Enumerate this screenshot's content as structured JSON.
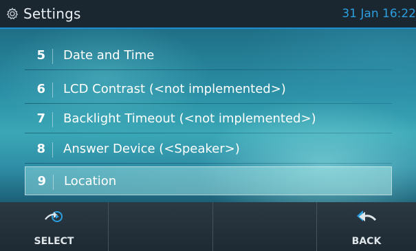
{
  "header": {
    "title": "Settings",
    "clock": "31 Jan 16:22",
    "icon": "gear-icon"
  },
  "colors": {
    "accent": "#1d8fd1",
    "clock": "#2b9fe0",
    "header_bg": "#1b2730",
    "footer_bg": "#24323c"
  },
  "menu": {
    "items": [
      {
        "number": "5",
        "label": "Date and Time"
      },
      {
        "number": "6",
        "label": "LCD Contrast (<not implemented>)"
      },
      {
        "number": "7",
        "label": "Backlight Timeout (<not implemented>)"
      },
      {
        "number": "8",
        "label": "Answer Device (<Speaker>)"
      },
      {
        "number": "9",
        "label": "Location"
      }
    ],
    "selected_index": 4
  },
  "softkeys": [
    {
      "label": "SELECT",
      "icon": "select-arrow-icon"
    },
    {
      "label": "",
      "icon": ""
    },
    {
      "label": "",
      "icon": ""
    },
    {
      "label": "BACK",
      "icon": "back-arrow-icon"
    }
  ]
}
